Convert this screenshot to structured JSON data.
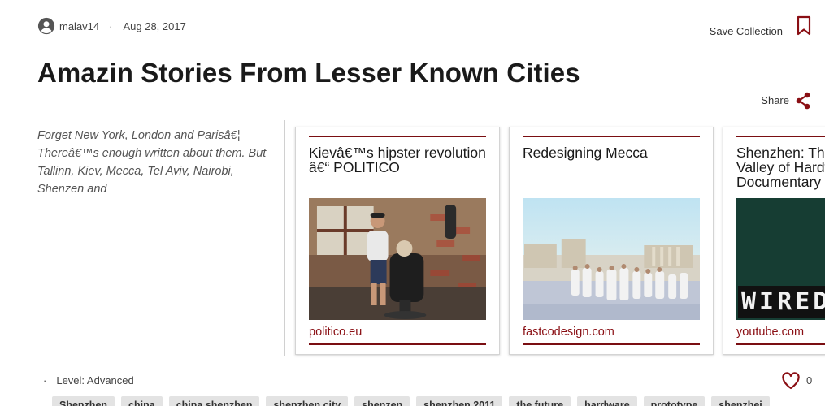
{
  "author": {
    "name": "malav14",
    "date": "Aug 28, 2017"
  },
  "save_label": "Save Collection",
  "title": "Amazin Stories From Lesser Known Cities",
  "share_label": "Share",
  "description": "Forget New York, London and Parisâ€¦ Thereâ€™s enough written about them. But Tallinn, Kiev, Mecca, Tel Aviv, Nairobi, Shenzen and",
  "cards": [
    {
      "title": "Kievâ€™s hipster revolution â€“ POLITICO",
      "source": "politico.eu",
      "image": "barber-shop-photo"
    },
    {
      "title": "Redesigning Mecca",
      "source": "fastcodesign.com",
      "image": "mecca-pilgrims-photo"
    },
    {
      "title": "Shenzhen: The Silicon Valley of Hardware | Documentary",
      "source": "youtube.com",
      "image": "wired-logo-thumbnail",
      "thumb_text": "WIRED"
    }
  ],
  "level": "Level: Advanced",
  "likes": "0",
  "tags": [
    "Shenzhen",
    "china",
    "china shenzhen",
    "shenzhen city",
    "shenzen",
    "shenzhen 2011",
    "the future",
    "hardware",
    "prototype",
    "shenzhei"
  ],
  "colors": {
    "accent": "#8a0f14",
    "card_rule": "#7a0e12",
    "tag_bg": "#e3e3e3"
  }
}
